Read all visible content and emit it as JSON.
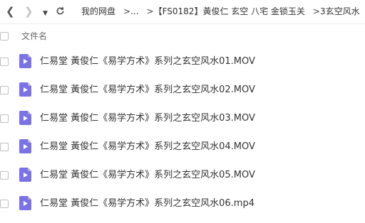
{
  "breadcrumbs": [
    "我的网盘",
    "...",
    "【FS0182】黃俊仁 玄空 八宅 金锁玉关",
    "3玄空风水"
  ],
  "breadcrumb_separator": ">",
  "columns": {
    "name": "文件名"
  },
  "files": [
    {
      "name": "仁易堂 黃俊仁《易学方术》系列之玄空风水01.MOV",
      "icon": "video-file-icon"
    },
    {
      "name": "仁易堂 黃俊仁《易学方术》系列之玄空风水02.MOV",
      "icon": "video-file-icon"
    },
    {
      "name": "仁易堂 黃俊仁《易学方术》系列之玄空风水03.MOV",
      "icon": "video-file-icon"
    },
    {
      "name": "仁易堂 黃俊仁《易学方术》系列之玄空风水04.MOV",
      "icon": "video-file-icon"
    },
    {
      "name": "仁易堂 黃俊仁《易学方术》系列之玄空风水05.MOV",
      "icon": "video-file-icon"
    },
    {
      "name": "仁易堂 黃俊仁《易学方术》系列之玄空风水06.mp4",
      "icon": "video-file-icon"
    }
  ],
  "colors": {
    "file_icon": "#7b73e3",
    "accent": "#333333"
  }
}
